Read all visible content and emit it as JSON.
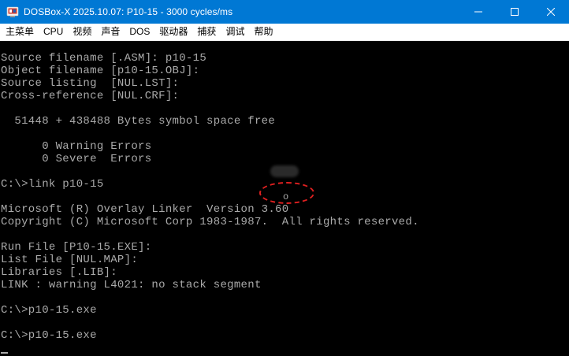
{
  "window": {
    "title": "DOSBox-X 2025.10.07: P10-15 - 3000 cycles/ms",
    "controls": [
      "minimize-icon",
      "maximize-icon",
      "close-icon"
    ]
  },
  "menubar": {
    "items": [
      "主菜单",
      "CPU",
      "视频",
      "声音",
      "DOS",
      "驱动器",
      "捕获",
      "调试",
      "帮助"
    ]
  },
  "console": {
    "text_color": "#aaaaaa",
    "background": "#000000",
    "lines": [
      "Source filename [.ASM]: p10-15",
      "Object filename [p10-15.OBJ]:",
      "Source listing  [NUL.LST]:",
      "Cross-reference [NUL.CRF]:",
      "",
      "  51448 + 438488 Bytes symbol space free",
      "",
      "      0 Warning Errors",
      "      0 Severe  Errors",
      "",
      "C:\\>link p10-15",
      "",
      "Microsoft (R) Overlay Linker  Version 3.60",
      "Copyright (C) Microsoft Corp 1983-1987.  All rights reserved.",
      "",
      "Run File [P10-15.EXE]:",
      "List File [NUL.MAP]:",
      "Libraries [.LIB]:",
      "LINK : warning L4021: no stack segment",
      "",
      "C:\\>p10-15.exe",
      "",
      "C:\\>p10-15.exe"
    ]
  },
  "annotation": {
    "char": "o",
    "color": "#e02020"
  }
}
